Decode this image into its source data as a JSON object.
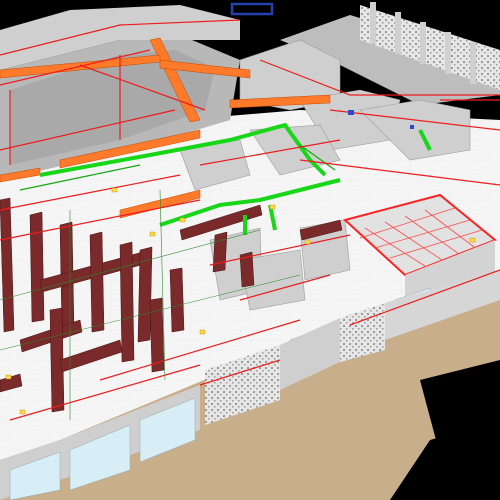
{
  "viewport": {
    "kind": "3D BIM MEP coordination view (isometric)",
    "background_color": "#000000",
    "ground_color": "#c9ae8c"
  },
  "model": {
    "building_shell_color": "#d8d8d8",
    "roof_slab_color": "#b8b8b8",
    "glass_color": "#d8eef6",
    "brick_screen_color": "#e6e6e6",
    "layers": [
      {
        "name": "fire-protection-piping",
        "color": "#ee1c1c"
      },
      {
        "name": "hvac-ductwork",
        "color": "#7a2a2a"
      },
      {
        "name": "hvac-supply-duct",
        "color": "#ff7a2a"
      },
      {
        "name": "plumbing-pipe",
        "color": "#18d618"
      },
      {
        "name": "cable-tray",
        "color": "#ffd84a"
      },
      {
        "name": "gridlines",
        "color": "#2e8b2e"
      }
    ]
  }
}
